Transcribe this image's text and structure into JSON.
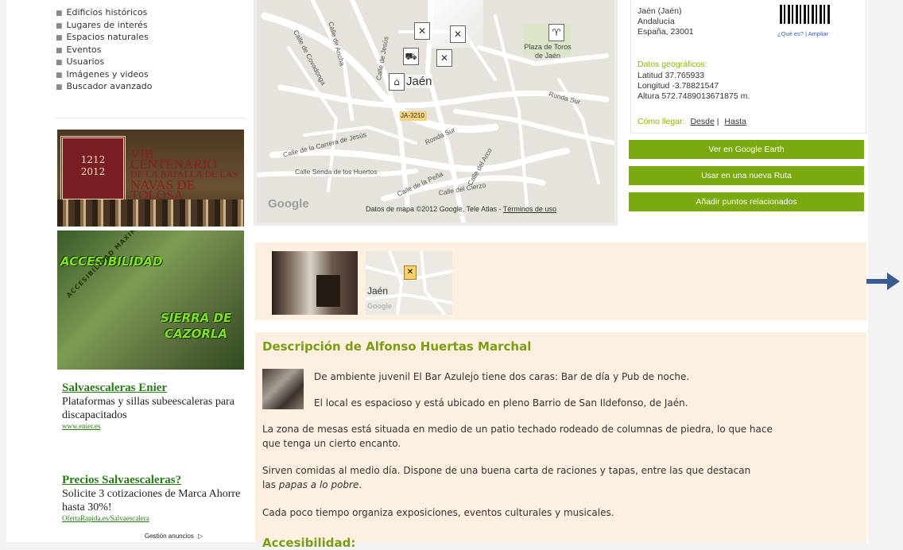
{
  "nav": {
    "items": [
      {
        "label": "Edificios históricos"
      },
      {
        "label": "Lugares de interés"
      },
      {
        "label": "Espacios naturales"
      },
      {
        "label": "Eventos"
      },
      {
        "label": "Usuarios"
      },
      {
        "label": "Imágenes y videos"
      },
      {
        "label": "Buscador avanzado"
      }
    ]
  },
  "banners": {
    "centenario": {
      "seal_top": "1212",
      "seal_bottom": "2012",
      "line1": "VIII CENTENARIO",
      "line2": "DE LA BATALLA DE LAS",
      "line3": "NAVAS DE TOLOSA"
    },
    "accesibilidad": {
      "word1": "ACCESIBILIDAD",
      "word2a": "SIERRA DE",
      "word2b": "CAZORLA",
      "diagonal": "ACCESIBILIDAD MAXIMA ASOCIACIONES"
    }
  },
  "ads": [
    {
      "title": "Salvaescaleras Enier",
      "desc": "Plataformas y sillas subeescaleras para discapacitados",
      "url": "www.enier.es"
    },
    {
      "title": "Precios Salvaescaleras?",
      "desc": "Solicite 3 cotizaciones de Marca Ahorre hasta 30%!",
      "url": "OfertaRapida.es/Salvaescalera"
    }
  ],
  "ads_footer": "Gestión anuncios",
  "map": {
    "streets": [
      "Calle de Covadonga",
      "Calle de Ancha",
      "Calle de Jesús",
      "Calle de la Carrera de Jesús",
      "Calle Senda de los Huertos",
      "Ronda Sur",
      "Calle de la Peña",
      "Calle del Cierzo",
      "Calle del Arco"
    ],
    "town_label": "Jaén",
    "plaza_label": "Plaza de Toros de Jaén",
    "road_badge": "JA-3210",
    "ronda_label": "Ronda Sur",
    "google_logo": "Google",
    "footer_text": "Datos de mapa ©2012 Google, Tele Atlas -",
    "footer_link": "Términos de uso"
  },
  "info": {
    "city": "Jaén (Jaén)",
    "region": "Andalucía",
    "country": "España, 23001",
    "qr_what": "¿Qué es?",
    "qr_sep": "|",
    "qr_enlarge": "Ampliar",
    "geo_title": "Datos geográficos:",
    "lat": "Latitud 37.765933",
    "lon": "Longitud -3.78821547",
    "alt": "Altura 572.7489013671875 m.",
    "how": "Cómo llegar:",
    "from": "Desde",
    "sep": "|",
    "to": "Hasta"
  },
  "actions": {
    "earth": "Ver en Google Earth",
    "route": "Usar en una nueva Ruta",
    "related": "Añadir puntos relacionados"
  },
  "photos": {
    "map_label": "Jaén",
    "google_logo": "Google"
  },
  "description": {
    "title": "Descripción de Alfonso Huertas Marchal",
    "p1": "De ambiente juvenil El Bar Azulejo tiene dos caras: Bar de día y Pub de noche.",
    "p2": "El local es espacioso y está ubicado en pleno Barrio de San Ildefonso, de Jaén.",
    "p3a": "La zona de mesas está situada en medio de un patio techado rodeado de columnas de piedra, lo que hace",
    "p3b": "que tenga un cierto encanto.",
    "p4a": "Sirven comidas al medio día. Dispone de una buena carta de raciones y tapas, entre las que destacan",
    "p4b": "las",
    "p4c": "papas a lo pobre",
    "p4d": ".",
    "p5": "Cada poco tiempo organiza exposiciones, eventos culturales y musicales.",
    "accessibility": "Accesibilidad:"
  },
  "colors": {
    "accent_green": "#7aaa10",
    "heading_green": "#7a9d12",
    "ad_green": "#2a7a1a",
    "panel_bg": "#fdf0e1",
    "arrow_blue": "#3b5b92"
  },
  "icons": [
    "restaurant-icon",
    "car-icon",
    "bank-icon",
    "bullfight-icon",
    "photo-icon",
    "next-arrow-icon",
    "ad-choices-icon"
  ]
}
